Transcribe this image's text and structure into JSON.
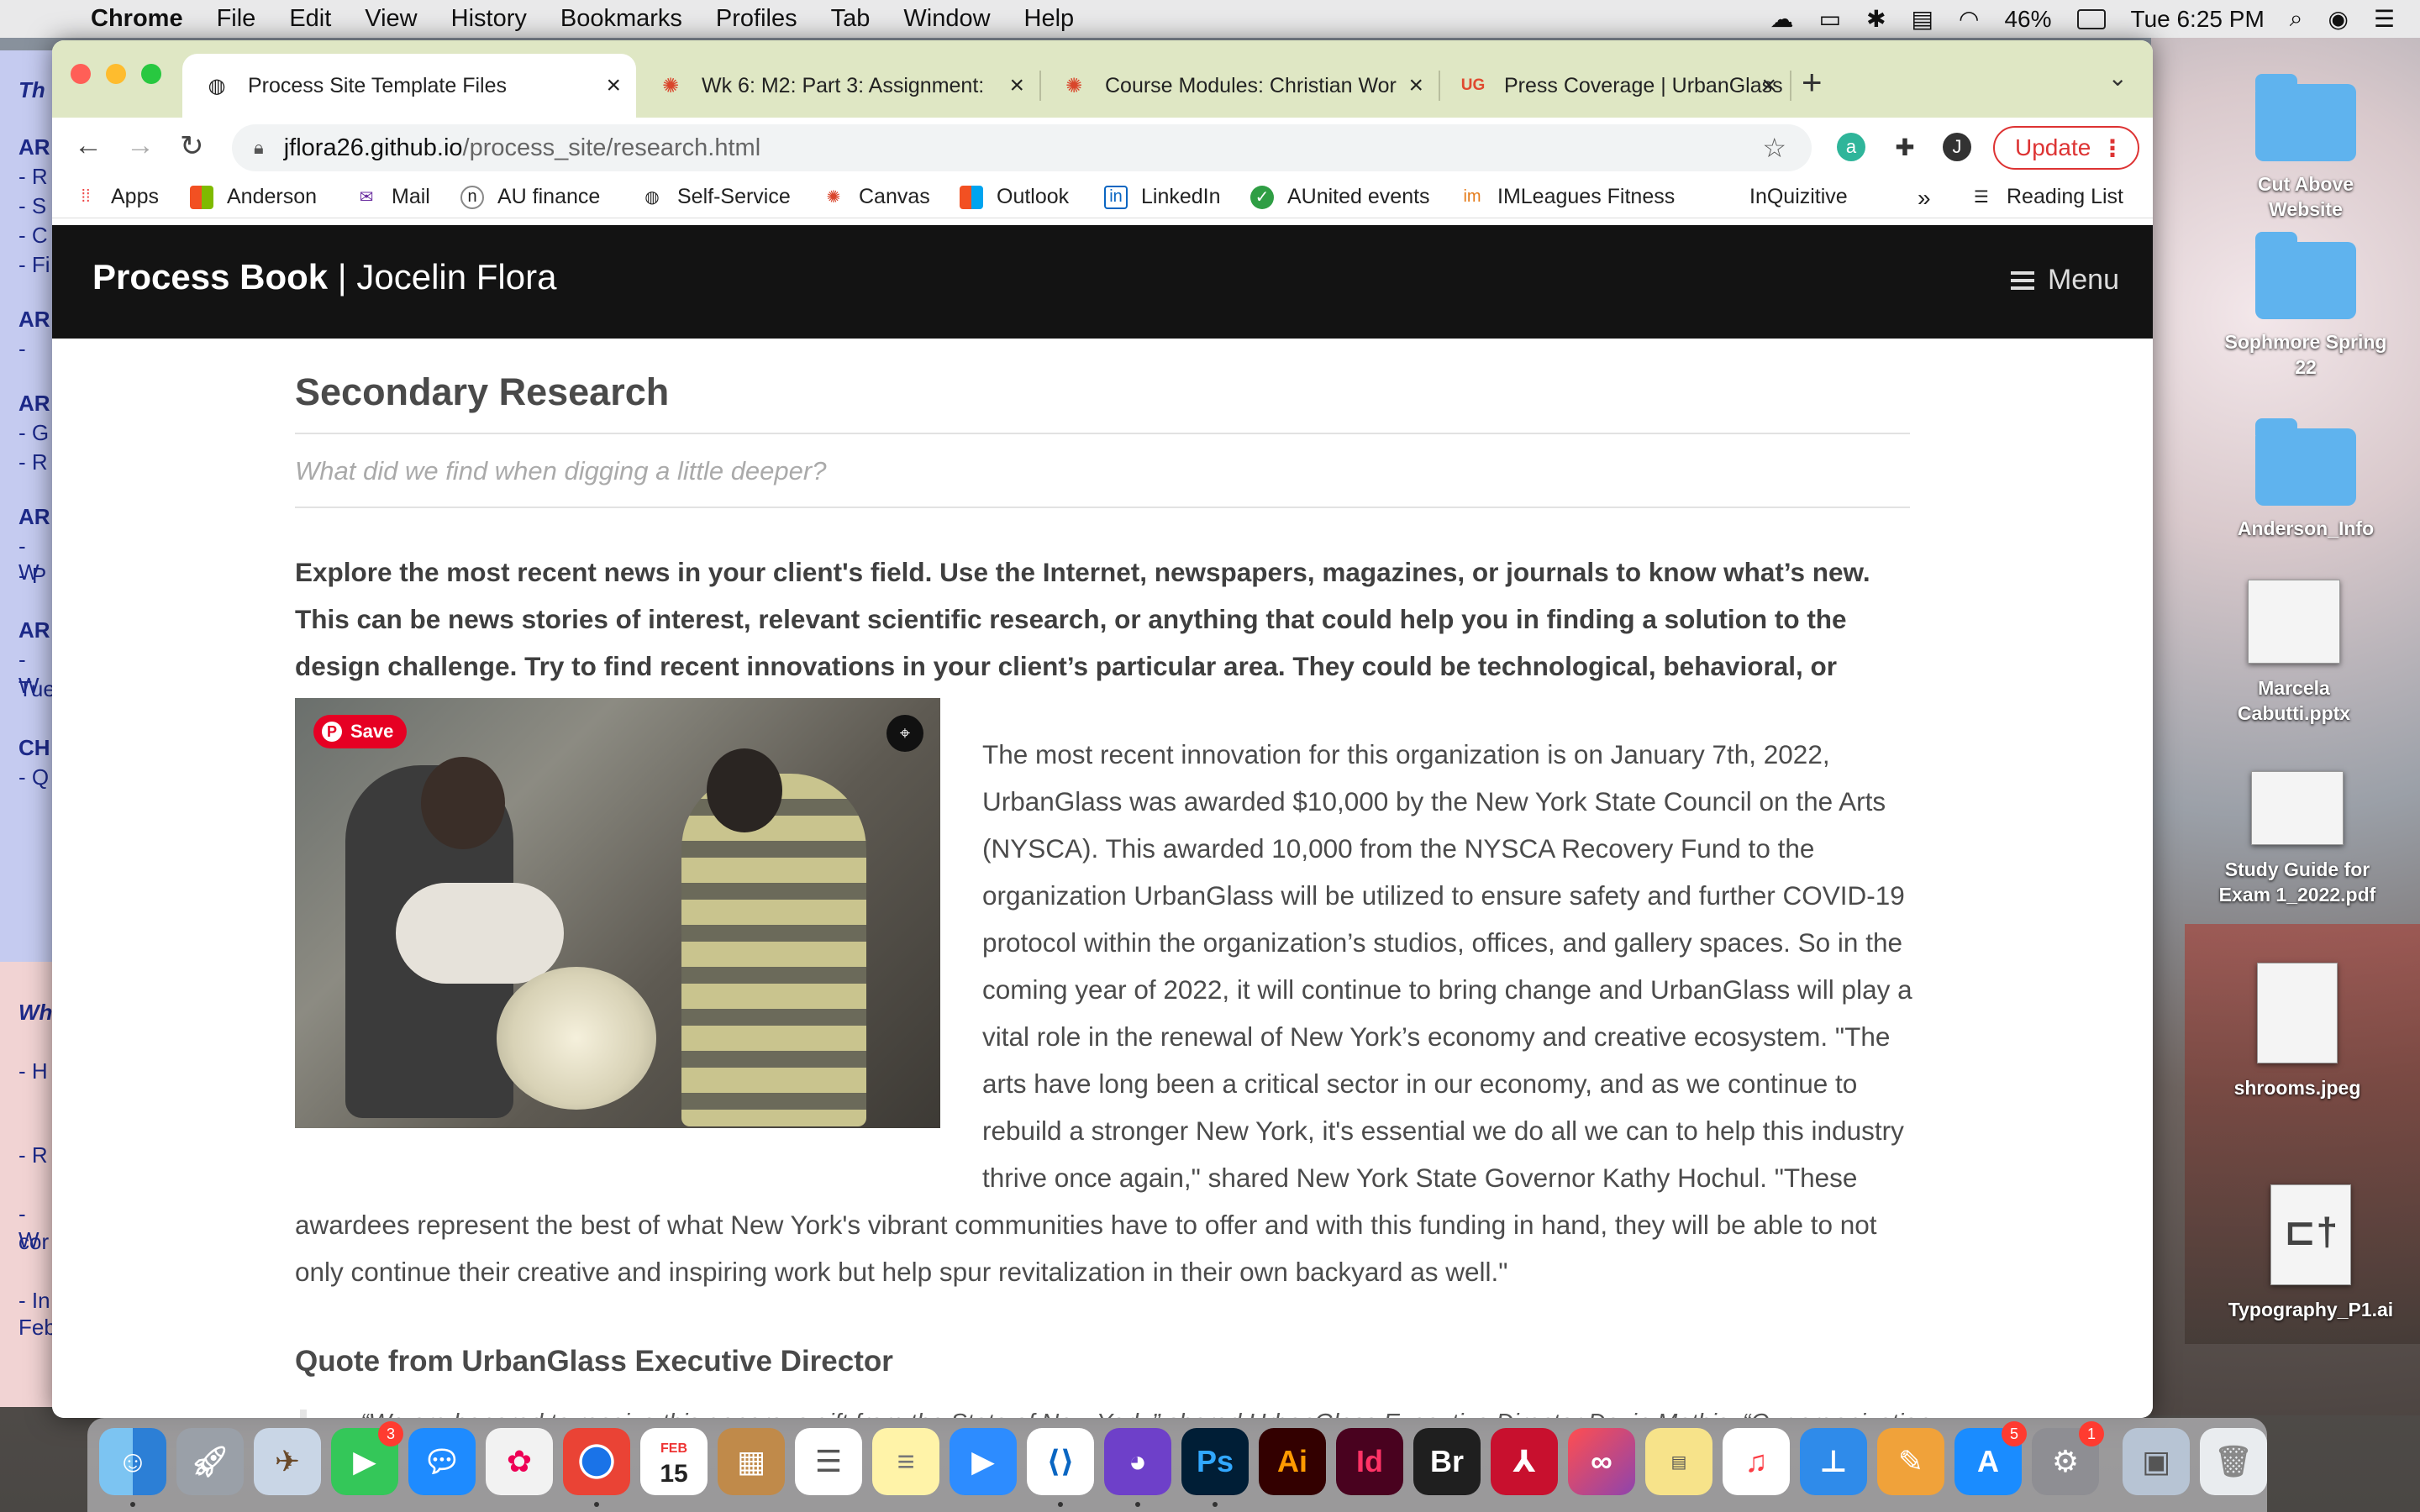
{
  "menubar": {
    "app": "Chrome",
    "items": [
      "File",
      "Edit",
      "View",
      "History",
      "Bookmarks",
      "Profiles",
      "Tab",
      "Window",
      "Help"
    ],
    "battery": "46%",
    "clock": "Tue 6:25 PM"
  },
  "tabs": [
    {
      "title": "Process Site Template Files",
      "icon": "globe-icon",
      "active": true
    },
    {
      "title": "Wk 6: M2: Part 3: Assignment:",
      "icon": "canvas-icon",
      "active": false
    },
    {
      "title": "Course Modules: Christian Wor",
      "icon": "canvas-icon",
      "active": false
    },
    {
      "title": "Press Coverage | UrbanGlass",
      "icon": "ug-icon",
      "favtext": "UG",
      "active": false
    }
  ],
  "address": {
    "host": "jflora26.github.io",
    "path": "/process_site/research.html"
  },
  "update_label": "Update",
  "profile_initial": "J",
  "bookmarks": [
    "Apps",
    "Anderson",
    "Mail",
    "AU finance",
    "Self-Service",
    "Canvas",
    "Outlook",
    "LinkedIn",
    "AUnited events",
    "IMLeagues Fitness",
    "InQuizitive"
  ],
  "bookmarks_more": "»",
  "reading_list": "Reading List",
  "site": {
    "brand_bold": "Process Book",
    "brand_sep": " | ",
    "brand_name": "Jocelin Flora",
    "menu_label": "Menu"
  },
  "page": {
    "heading": "Secondary Research",
    "subheading": "What did we find when digging a little deeper?",
    "lead": "Explore the most recent news in your client's field. Use the Internet, newspapers, magazines, or journals to know what’s new. This can be news stories of interest, relevant scientific research, or anything that could help you in finding a solution to the design challenge. Try to find recent innovations in your client’s particular area. They could be technological, behavioral, or cultural.",
    "pin_label": "Save",
    "body": "The most recent innovation for this organization is on January 7th, 2022, UrbanGlass was awarded $10,000 by the New York State Council on the Arts (NYSCA). This awarded 10,000 from the NYSCA Recovery Fund to the organization UrbanGlass will be utilized to ensure safety and further COVID-19 protocol within the organization’s studios, offices, and gallery spaces. So in the coming year of 2022, it will continue to bring change and UrbanGlass will play a vital role in the renewal of New York’s economy and creative ecosystem. \"The arts have long been a critical sector in our economy, and as we continue to rebuild a stronger New York, it's essential we do all we can to help this industry thrive once again,\" shared New York State Governor Kathy Hochul. \"These awardees represent the best of what New York's vibrant communities have to offer and with this funding in hand, they will be able to not only continue their creative and inspiring work but help spur revitalization in their own backyard as well.\"",
    "section_heading": "Quote from UrbanGlass Executive Director",
    "quote": "“We are honored to receive this generous gift from the State of New York,” shared UrbanGlass Executive Director Devin Mathis. “Our organization"
  },
  "desktop": [
    {
      "label": "Cut Above Website",
      "kind": "folder"
    },
    {
      "label": "Sophmore Spring 22",
      "kind": "folder"
    },
    {
      "label": "Anderson_Info",
      "kind": "folder"
    },
    {
      "label": "Marcela Cabutti.pptx",
      "kind": "doc"
    },
    {
      "label": "Study Guide for Exam 1_2022.pdf",
      "kind": "doc"
    },
    {
      "label": "shrooms.jpeg",
      "kind": "doc"
    },
    {
      "label": "Typography_P1.ai",
      "kind": "doc"
    }
  ],
  "behind_doc": {
    "left_labels": [
      "Th",
      "AR",
      "- R",
      "- S",
      "- C",
      "- Fi",
      "AR",
      "-",
      "AR",
      "- G",
      "- R",
      "AR",
      "- W",
      "- P",
      "AR",
      "- W",
      "Tue",
      "CH",
      "- Q"
    ],
    "left_labels2": [
      "Wh",
      "- H",
      "- R",
      "- W",
      "cor",
      "- In",
      "Feb"
    ]
  },
  "dock": {
    "facetime_badge": "3",
    "calendar_month": "FEB",
    "calendar_day": "15",
    "appstore_badge": "5",
    "settings_badge": "1",
    "ps": "Ps",
    "ai": "Ai",
    "id": "Id",
    "br": "Br"
  }
}
